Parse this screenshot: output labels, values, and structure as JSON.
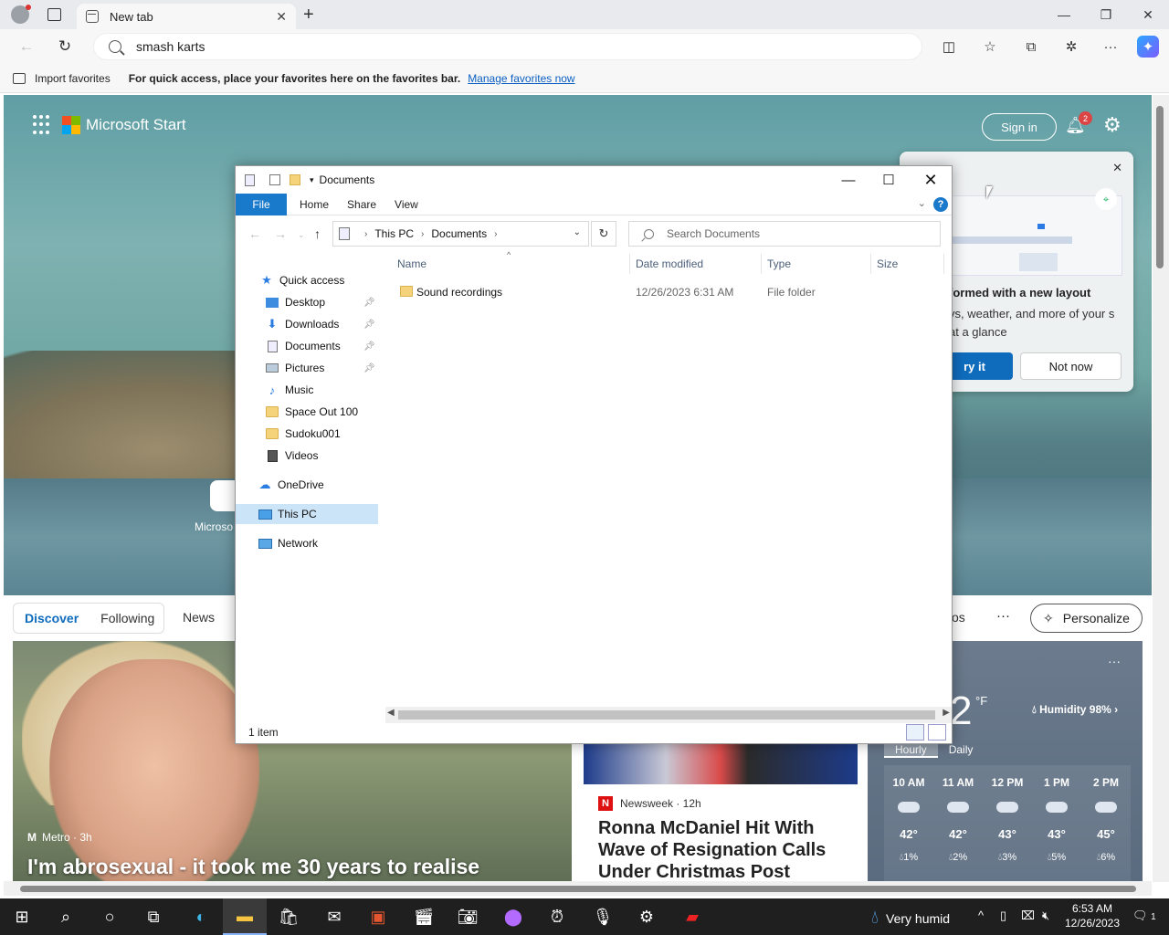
{
  "browser": {
    "tab_title": "New tab",
    "address_text": "smash karts",
    "favbar": {
      "import_label": "Import favorites",
      "message": "For quick access, place your favorites here on the favorites bar.",
      "link": "Manage favorites now"
    }
  },
  "start": {
    "brand": "Microsoft Start",
    "sign_in": "Sign in",
    "notif_count": "2",
    "popup": {
      "title": "formed with a new layout",
      "desc": "vs, weather, and more of your s at a glance",
      "try_label": "ry it",
      "notnow_label": "Not now"
    },
    "shortcut_label": "Microso",
    "tabs": [
      "Discover",
      "Following"
    ],
    "news_label": "News",
    "os_label": "os",
    "more_label": "···",
    "personalize": "Personalize",
    "card1": {
      "source": "Metro · 3h",
      "headline": "I'm abrosexual - it took me 30 years to realise"
    },
    "card2": {
      "source": "Newsweek · 12h",
      "headline": "Ronna McDaniel Hit With Wave of Resignation Calls Under Christmas Post"
    },
    "weather": {
      "temp": "2",
      "unit": "°F",
      "humidity": "Humidity 98%",
      "tabs": [
        "Hourly",
        "Daily"
      ],
      "hours": [
        {
          "time": "10 AM",
          "temp": "42°",
          "precip": "1%"
        },
        {
          "time": "11 AM",
          "temp": "42°",
          "precip": "2%"
        },
        {
          "time": "12 PM",
          "temp": "43°",
          "precip": "3%"
        },
        {
          "time": "1 PM",
          "temp": "43°",
          "precip": "5%"
        },
        {
          "time": "2 PM",
          "temp": "45°",
          "precip": "6%"
        }
      ]
    }
  },
  "explorer": {
    "title": "Documents",
    "ribbon": {
      "file": "File",
      "home": "Home",
      "share": "Share",
      "view": "View"
    },
    "path": [
      "This PC",
      "Documents"
    ],
    "search_placeholder": "Search Documents",
    "tree": {
      "quick_access": "Quick access",
      "items": [
        "Desktop",
        "Downloads",
        "Documents",
        "Pictures",
        "Music",
        "Space Out 100",
        "Sudoku001",
        "Videos"
      ],
      "onedrive": "OneDrive",
      "thispc": "This PC",
      "network": "Network"
    },
    "columns": {
      "name": "Name",
      "date": "Date modified",
      "type": "Type",
      "size": "Size"
    },
    "rows": [
      {
        "name": "Sound recordings",
        "date": "12/26/2023 6:31 AM",
        "type": "File folder",
        "size": ""
      }
    ],
    "status": "1 item"
  },
  "taskbar": {
    "weather": "Very humid",
    "time": "6:53 AM",
    "date": "12/26/2023",
    "notif": "1"
  }
}
